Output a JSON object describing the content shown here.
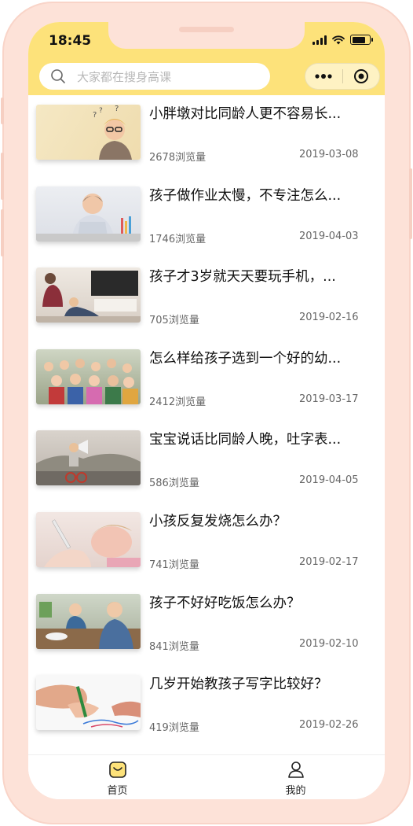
{
  "status_bar": {
    "time": "18:45"
  },
  "search": {
    "placeholder": "大家都在搜身高课"
  },
  "colors": {
    "accent": "#fde27a",
    "frame": "#fde2d8"
  },
  "articles": [
    {
      "title": "小胖墩对比同龄人更不容易长...",
      "views": "2678浏览量",
      "date": "2019-03-08",
      "image": "thinking-boy-with-glasses"
    },
    {
      "title": "孩子做作业太慢，不专注怎么...",
      "views": "1746浏览量",
      "date": "2019-04-03",
      "image": "boy-doing-homework"
    },
    {
      "title": "孩子才3岁就天天要玩手机，...",
      "views": "705浏览量",
      "date": "2019-02-16",
      "image": "living-room-family"
    },
    {
      "title": "怎么样给孩子选到一个好的幼...",
      "views": "2412浏览量",
      "date": "2019-03-17",
      "image": "group-of-kids"
    },
    {
      "title": "宝宝说话比同龄人晚，吐字表...",
      "views": "586浏览量",
      "date": "2019-04-05",
      "image": "child-with-megaphone"
    },
    {
      "title": "小孩反复发烧怎么办？",
      "views": "741浏览量",
      "date": "2019-02-17",
      "image": "child-thermometer"
    },
    {
      "title": "孩子不好好吃饭怎么办？",
      "views": "841浏览量",
      "date": "2019-02-10",
      "image": "kids-eating"
    },
    {
      "title": "几岁开始教孩子写字比较好？",
      "views": "419浏览量",
      "date": "2019-02-26",
      "image": "child-hand-writing"
    }
  ],
  "tabbar": [
    {
      "label": "首页",
      "icon": "home-bag-icon"
    },
    {
      "label": "我的",
      "icon": "user-icon"
    }
  ]
}
